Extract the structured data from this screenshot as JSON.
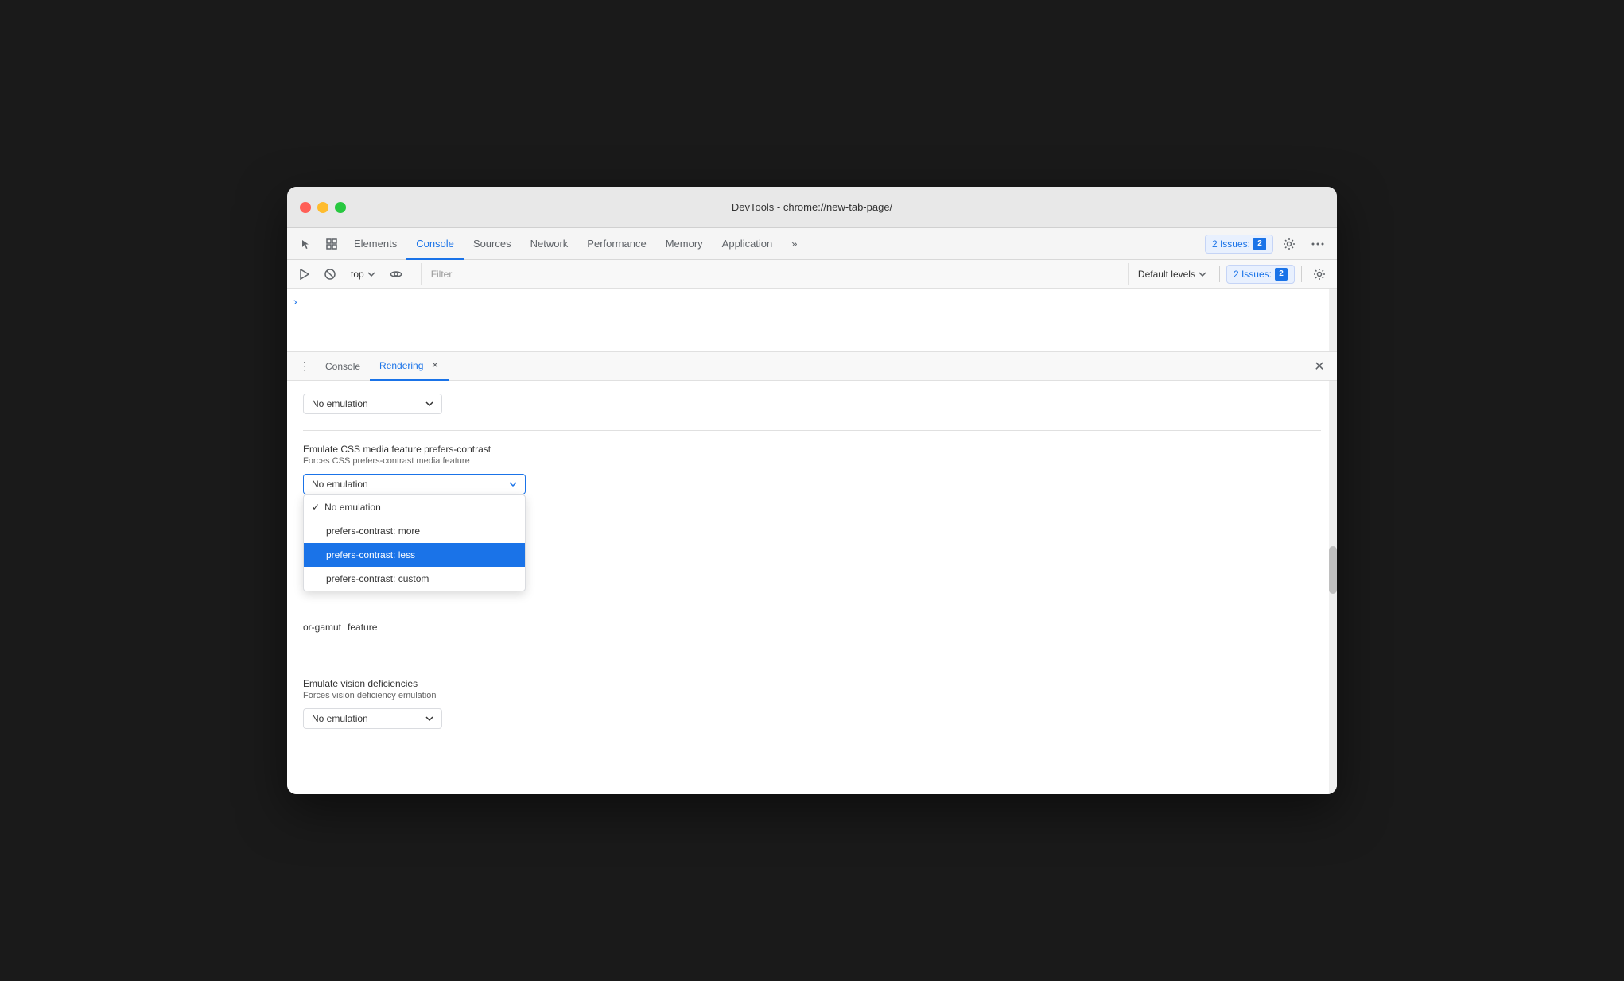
{
  "window": {
    "title": "DevTools - chrome://new-tab-page/"
  },
  "tabs": {
    "items": [
      {
        "id": "elements",
        "label": "Elements",
        "active": false
      },
      {
        "id": "console",
        "label": "Console",
        "active": true
      },
      {
        "id": "sources",
        "label": "Sources",
        "active": false
      },
      {
        "id": "network",
        "label": "Network",
        "active": false
      },
      {
        "id": "performance",
        "label": "Performance",
        "active": false
      },
      {
        "id": "memory",
        "label": "Memory",
        "active": false
      },
      {
        "id": "application",
        "label": "Application",
        "active": false
      }
    ],
    "more_label": "»",
    "issues_label": "2 Issues:",
    "issues_count": "2"
  },
  "toolbar": {
    "top_label": "top",
    "filter_placeholder": "Filter",
    "default_levels_label": "Default levels"
  },
  "bottom_panel": {
    "tabs": [
      {
        "id": "console",
        "label": "Console",
        "active": false
      },
      {
        "id": "rendering",
        "label": "Rendering",
        "active": true
      }
    ]
  },
  "rendering": {
    "section1": {
      "label": "No emulation",
      "select_value": "No emulation"
    },
    "prefers_contrast": {
      "title": "Emulate CSS media feature prefers-contrast",
      "description": "Forces CSS prefers-contrast media feature",
      "select_value": "No emulation",
      "dropdown": {
        "options": [
          {
            "id": "no-emulation",
            "label": "No emulation",
            "checked": true,
            "highlighted": false
          },
          {
            "id": "more",
            "label": "prefers-contrast: more",
            "checked": false,
            "highlighted": false
          },
          {
            "id": "less",
            "label": "prefers-contrast: less",
            "checked": false,
            "highlighted": true
          },
          {
            "id": "custom",
            "label": "prefers-contrast: custom",
            "checked": false,
            "highlighted": false
          }
        ]
      }
    },
    "color_gamut": {
      "partial_label": "or-gamut",
      "partial_desc": "feature"
    },
    "vision_deficiencies": {
      "title": "Emulate vision deficiencies",
      "description": "Forces vision deficiency emulation",
      "select_value": "No emulation"
    }
  }
}
